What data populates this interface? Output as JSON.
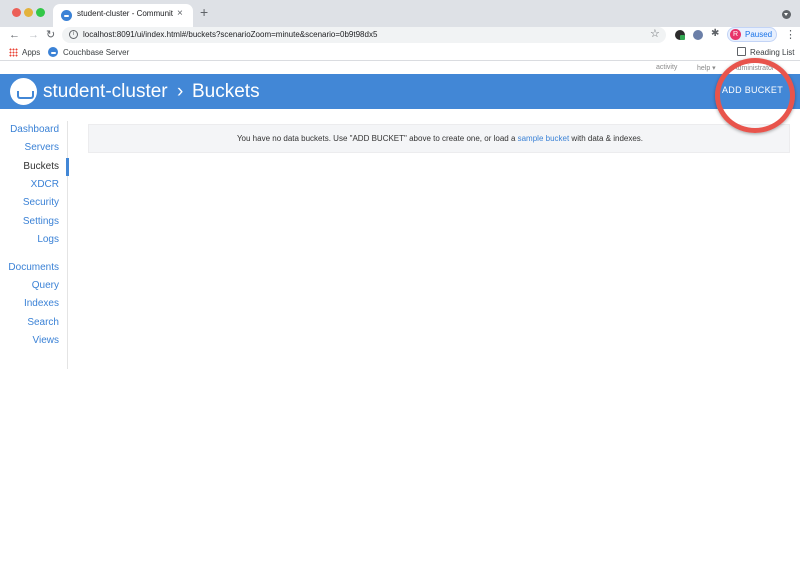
{
  "browser": {
    "tab_title": "student-cluster - Community E",
    "tab_close": "×",
    "new_tab": "+",
    "url": "localhost:8091/ui/index.html#/buckets?scenarioZoom=minute&scenario=0b9t98dx5",
    "profile_initial": "R",
    "profile_label": "Paused",
    "bookmarks": {
      "apps": "Apps",
      "couchbase": "Couchbase Server",
      "reading_list": "Reading List"
    }
  },
  "utility": {
    "activity": "activity",
    "help": "help ▾",
    "admin": "Administrator ▾"
  },
  "header": {
    "cluster": "student-cluster",
    "separator": "›",
    "page": "Buckets",
    "add_bucket": "ADD BUCKET",
    "brand_color": "#4287d6",
    "highlight_color": "#e8544c"
  },
  "sidebar": {
    "items": [
      {
        "label": "Dashboard",
        "active": false
      },
      {
        "label": "Servers",
        "active": false
      },
      {
        "label": "Buckets",
        "active": true
      },
      {
        "label": "XDCR",
        "active": false
      },
      {
        "label": "Security",
        "active": false
      },
      {
        "label": "Settings",
        "active": false
      },
      {
        "label": "Logs",
        "active": false
      },
      {
        "label": "Documents",
        "active": false
      },
      {
        "label": "Query",
        "active": false
      },
      {
        "label": "Indexes",
        "active": false
      },
      {
        "label": "Search",
        "active": false
      },
      {
        "label": "Views",
        "active": false
      }
    ]
  },
  "main": {
    "notice_before": "You have no data buckets. Use \"ADD BUCKET\" above to create one, or load a ",
    "notice_link": "sample bucket",
    "notice_after": " with data & indexes."
  },
  "icons": {
    "back": "←",
    "forward": "→",
    "reload": "↻",
    "star": "☆",
    "puzzle": "✱",
    "kebab": "⋮",
    "info": "i"
  }
}
